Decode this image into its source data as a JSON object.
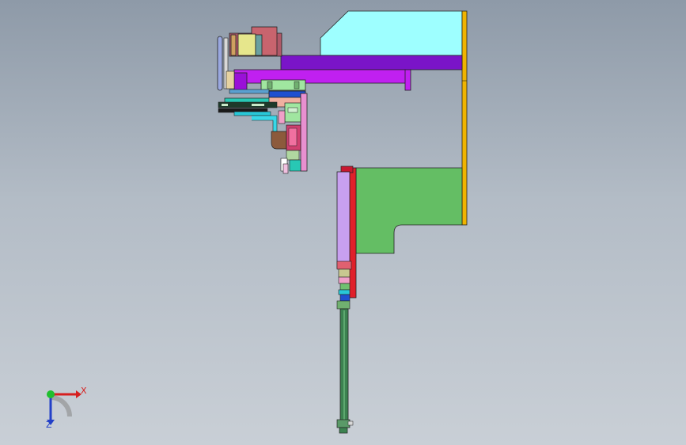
{
  "viewport": {
    "background_top": "#8e9aa8",
    "background_bottom": "#c9cfd6"
  },
  "triad": {
    "x_label": "X",
    "z_label": "Z",
    "x_color": "#d61f1f",
    "y_color": "#1fbf2e",
    "z_color": "#2340c8"
  },
  "model": {
    "colors": {
      "cyan_housing": "#9effff",
      "orange_frame": "#f0b400",
      "purple_beam": "#7a14c8",
      "magenta_rail": "#c020f0",
      "green_plate": "#64be64",
      "lavender_slide": "#c8a0f0",
      "red_rail": "#e0202a",
      "shaft_green": "#3c8250",
      "brown_bracket": "#8c5a3c",
      "pink_block": "#f0a0c8",
      "light_green_block": "#a0e6a0",
      "motor_yellow": "#e6e68c",
      "motor_rose": "#c8646e",
      "teal": "#28c8b4",
      "blue_small": "#3c64dc"
    }
  }
}
